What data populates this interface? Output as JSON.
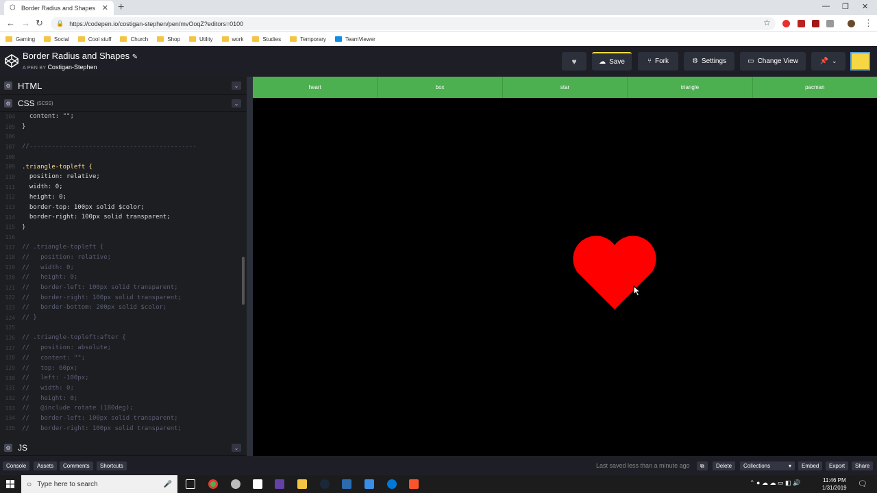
{
  "browser": {
    "tab_title": "Border Radius and Shapes",
    "tab_close": "✕",
    "new_tab": "+",
    "url": "https://codepen.io/costigan-stephen/pen/mvOoqZ?editors=0100",
    "bookmarks": [
      "Gaming",
      "Social",
      "Cool stuff",
      "Church",
      "Shop",
      "Utility",
      "work",
      "Studies",
      "Temporary",
      "TeamViewer"
    ]
  },
  "codepen": {
    "title": "Border Radius and Shapes",
    "pen_by_label": "A PEN BY",
    "author": "Costigan-Stephen",
    "buttons": {
      "save": "Save",
      "fork": "Fork",
      "settings": "Settings",
      "change_view": "Change View"
    }
  },
  "editor": {
    "html_label": "HTML",
    "css_label": "CSS",
    "css_sub": "(SCSS)",
    "js_label": "JS",
    "code_lines": [
      {
        "n": "104",
        "t": "  content: \"\";",
        "c": "#ccc"
      },
      {
        "n": "105",
        "t": "}",
        "c": "#ccc"
      },
      {
        "n": "106",
        "t": "",
        "c": "#ccc"
      },
      {
        "n": "107",
        "t": "//---------------------------------------------",
        "c": "#5a5f73"
      },
      {
        "n": "108",
        "t": "",
        "c": "#ccc"
      },
      {
        "n": "109",
        "t": ".triangle-topleft {",
        "c": "#ffdd88"
      },
      {
        "n": "110",
        "t": "  position: relative;",
        "c": "#ddd"
      },
      {
        "n": "111",
        "t": "  width: 0;",
        "c": "#ddd"
      },
      {
        "n": "112",
        "t": "  height: 0;",
        "c": "#ddd"
      },
      {
        "n": "113",
        "t": "  border-top: 100px solid $color;",
        "c": "#ddd"
      },
      {
        "n": "114",
        "t": "  border-right: 100px solid transparent;",
        "c": "#ddd"
      },
      {
        "n": "115",
        "t": "}",
        "c": "#ccc"
      },
      {
        "n": "116",
        "t": "",
        "c": "#ccc"
      },
      {
        "n": "117",
        "t": "// .triangle-topleft {",
        "c": "#5a5f73"
      },
      {
        "n": "118",
        "t": "//   position: relative;",
        "c": "#5a5f73"
      },
      {
        "n": "119",
        "t": "//   width: 0;",
        "c": "#5a5f73"
      },
      {
        "n": "120",
        "t": "//   height: 0;",
        "c": "#5a5f73"
      },
      {
        "n": "121",
        "t": "//   border-left: 100px solid transparent;",
        "c": "#5a5f73"
      },
      {
        "n": "122",
        "t": "//   border-right: 100px solid transparent;",
        "c": "#5a5f73"
      },
      {
        "n": "123",
        "t": "//   border-bottom: 200px solid $color;",
        "c": "#5a5f73"
      },
      {
        "n": "124",
        "t": "// }",
        "c": "#5a5f73"
      },
      {
        "n": "125",
        "t": "",
        "c": "#ccc"
      },
      {
        "n": "126",
        "t": "// .triangle-topleft:after {",
        "c": "#5a5f73"
      },
      {
        "n": "127",
        "t": "//   position: absolute;",
        "c": "#5a5f73"
      },
      {
        "n": "128",
        "t": "//   content: \"\";",
        "c": "#5a5f73"
      },
      {
        "n": "129",
        "t": "//   top: 60px;",
        "c": "#5a5f73"
      },
      {
        "n": "130",
        "t": "//   left: -100px;",
        "c": "#5a5f73"
      },
      {
        "n": "131",
        "t": "//   width: 0;",
        "c": "#5a5f73"
      },
      {
        "n": "132",
        "t": "//   height: 0;",
        "c": "#5a5f73"
      },
      {
        "n": "133",
        "t": "//   @include rotate (180deg);",
        "c": "#5a5f73"
      },
      {
        "n": "134",
        "t": "//   border-left: 100px solid transparent;",
        "c": "#5a5f73"
      },
      {
        "n": "135",
        "t": "//   border-right: 100px solid transparent;",
        "c": "#5a5f73"
      }
    ]
  },
  "preview": {
    "nav": [
      "heart",
      "box",
      "star",
      "triangle",
      "pacman"
    ],
    "heart_color": "#ff0000",
    "nav_color": "#4caf50"
  },
  "footer": {
    "left_buttons": [
      "Console",
      "Assets",
      "Comments",
      "Shortcuts"
    ],
    "last_saved": "Last saved less than a minute ago",
    "delete": "Delete",
    "collections": "Collections",
    "embed": "Embed",
    "export": "Export",
    "share": "Share"
  },
  "taskbar": {
    "search_placeholder": "Type here to search",
    "time": "11:46 PM",
    "date": "1/31/2019"
  }
}
